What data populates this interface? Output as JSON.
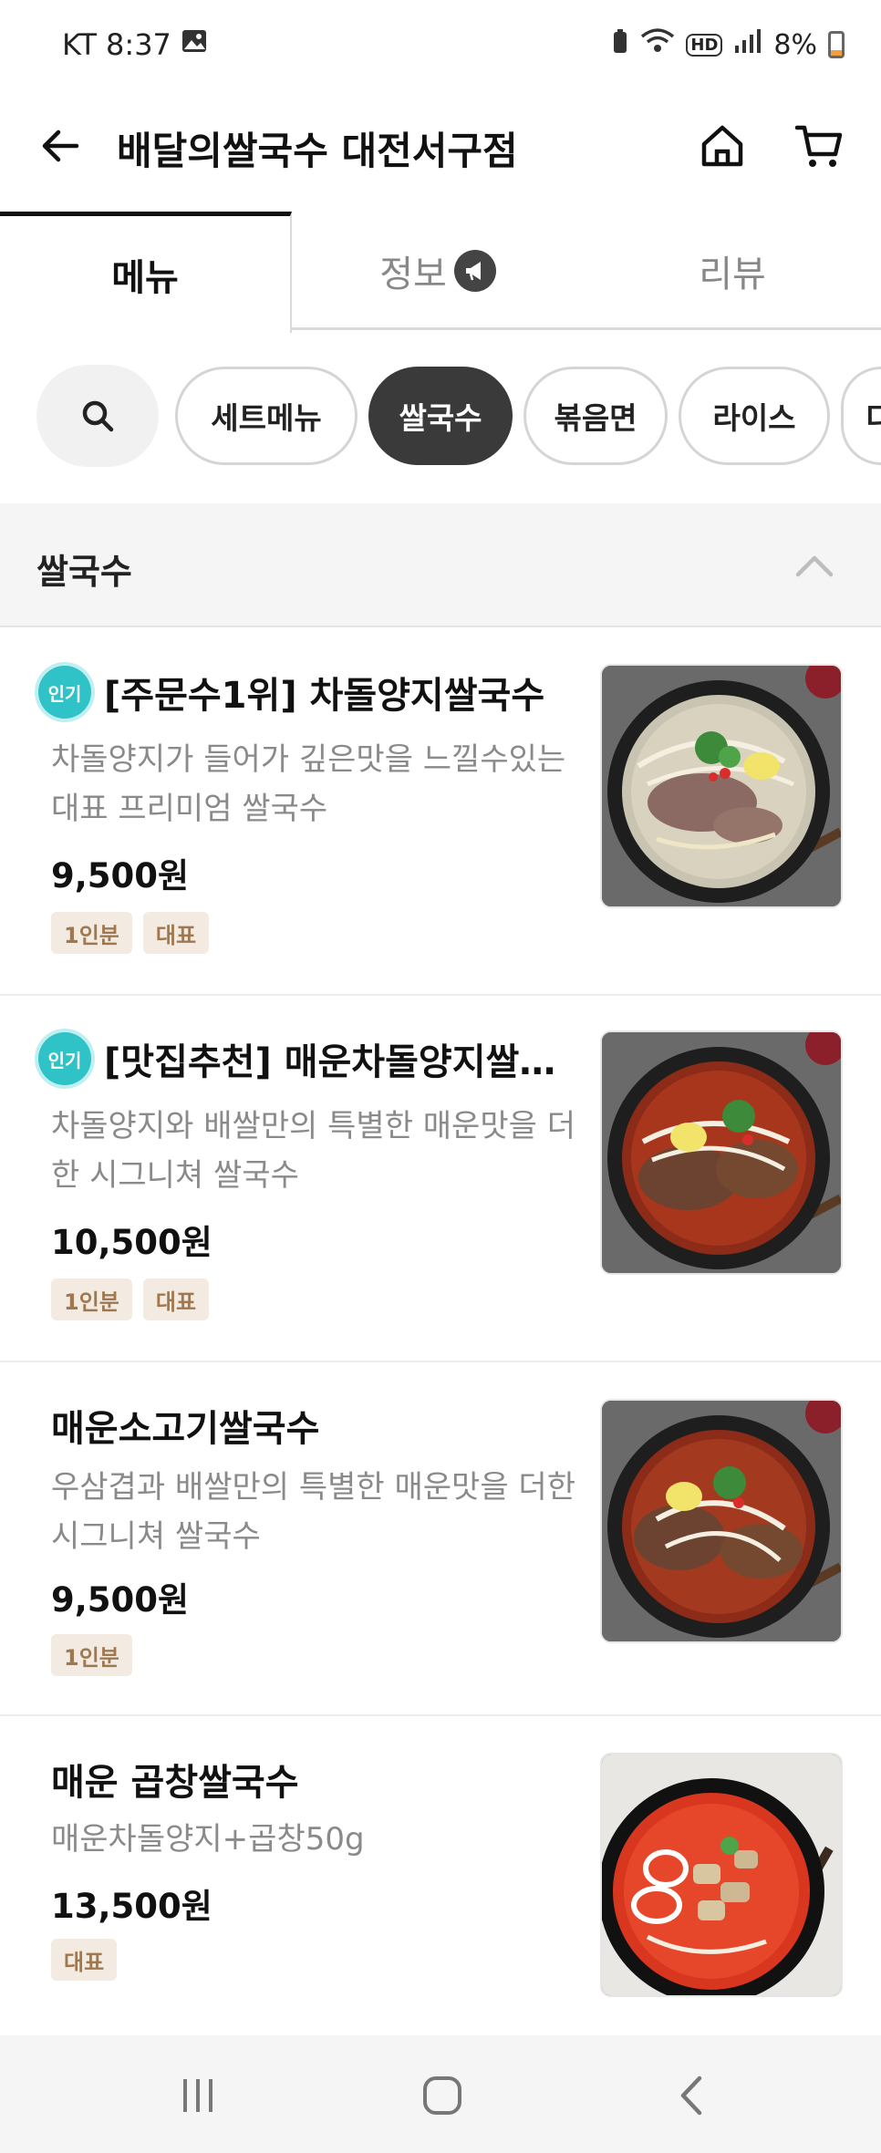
{
  "status_bar": {
    "carrier": "KT",
    "time": "8:37",
    "battery": "8%",
    "hd_label": "HD"
  },
  "header": {
    "title": "배달의쌀국수 대전서구점"
  },
  "tabs": [
    {
      "label": "메뉴",
      "active": true
    },
    {
      "label": "정보",
      "active": false
    },
    {
      "label": "리뷰",
      "active": false
    }
  ],
  "categories": [
    {
      "label": "세트메뉴",
      "selected": false
    },
    {
      "label": "쌀국수",
      "selected": true
    },
    {
      "label": "볶음면",
      "selected": false
    },
    {
      "label": "라이스",
      "selected": false
    },
    {
      "label": "디",
      "selected": false
    }
  ],
  "section": {
    "title": "쌀국수"
  },
  "menu_items": [
    {
      "popular_badge": "인기",
      "name": "[주문수1위] 차돌양지쌀국수",
      "description": "차돌양지가 들어가 깊은맛을 느낄수있는 대표 프리미엄 쌀국수",
      "price": "9,500원",
      "tags": [
        "1인분",
        "대표"
      ]
    },
    {
      "popular_badge": "인기",
      "name": "[맛집추천] 매운차돌양지쌀…",
      "description": "차돌양지와 배쌀만의 특별한 매운맛을 더한 시그니쳐 쌀국수",
      "price": "10,500원",
      "tags": [
        "1인분",
        "대표"
      ]
    },
    {
      "popular_badge": "",
      "name": "매운소고기쌀국수",
      "description": "우삼겹과 배쌀만의 특별한 매운맛을 더한 시그니쳐 쌀국수",
      "price": "9,500원",
      "tags": [
        "1인분"
      ]
    },
    {
      "popular_badge": "",
      "name": "매운 곱창쌀국수",
      "description": "매운차돌양지+곱창50g",
      "price": "13,500원",
      "tags": [
        "대표"
      ]
    }
  ]
}
